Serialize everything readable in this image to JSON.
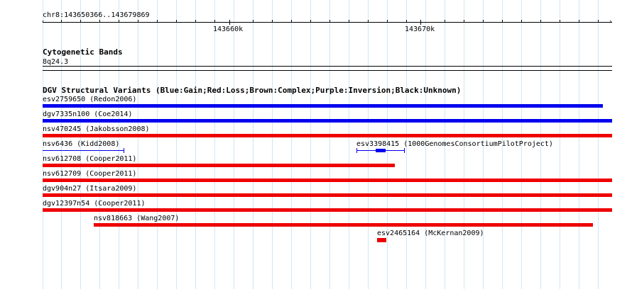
{
  "ruler": {
    "location": "chr8:143650366..143679869",
    "tick_labels": [
      "143660k",
      "143670k"
    ]
  },
  "cyto": {
    "title": "Cytogenetic Bands",
    "band": "8q24.3"
  },
  "dgv": {
    "title": "DGV Structural Variants (Blue:Gain;Red:Loss;Brown:Complex;Purple:Inversion;Black:Unknown)",
    "colors": {
      "gain": "#0000ee",
      "loss": "#ee0000"
    },
    "features": [
      {
        "name": "esv2759650 (Redon2006)",
        "type": "gain"
      },
      {
        "name": "dgv7335n100 (Coe2014)",
        "type": "gain"
      },
      {
        "name": "nsv470245 (Jakobsson2008)",
        "type": "loss"
      },
      {
        "name": "nsv6436 (Kidd2008)",
        "type": "gain"
      },
      {
        "name": "esv3398415 (1000GenomesConsortiumPilotProject)",
        "type": "gain"
      },
      {
        "name": "nsv612708 (Cooper2011)",
        "type": "loss"
      },
      {
        "name": "nsv612709 (Cooper2011)",
        "type": "loss"
      },
      {
        "name": "dgv904n27 (Itsara2009)",
        "type": "loss"
      },
      {
        "name": "dgv12397n54 (Cooper2011)",
        "type": "loss"
      },
      {
        "name": "nsv818663 (Wang2007)",
        "type": "loss"
      },
      {
        "name": "esv2465164 (McKernan2009)",
        "type": "loss"
      }
    ]
  }
}
